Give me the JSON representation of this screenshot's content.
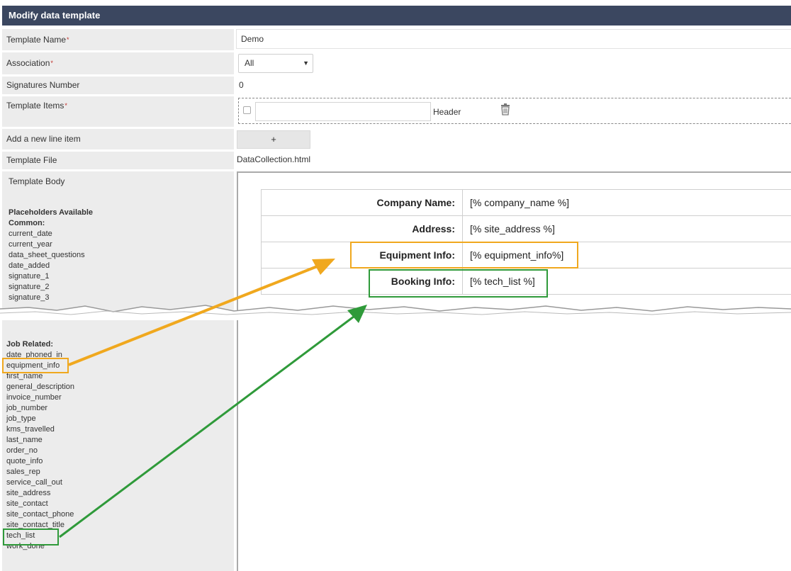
{
  "title": "Modify data template",
  "form": {
    "template_name_label": "Template Name",
    "template_name_value": "Demo",
    "association_label": "Association",
    "association_value": "All",
    "signatures_label": "Signatures Number",
    "signatures_value": "0",
    "template_items_label": "Template Items",
    "item_header_text": "Header",
    "add_line_label": "Add a new line item",
    "add_button": "+",
    "template_file_label": "Template File",
    "template_file_value": "DataCollection.html",
    "template_body_label": "Template Body",
    "required_mark": "*"
  },
  "placeholders": {
    "title": "Placeholders Available",
    "common_title": "Common:",
    "common": [
      "current_date",
      "current_year",
      "data_sheet_questions",
      "date_added",
      "signature_1",
      "signature_2",
      "signature_3"
    ],
    "job_title": "Job Related:",
    "job": [
      "date_phoned_in",
      "equipment_info",
      "first_name",
      "general_description",
      "invoice_number",
      "job_number",
      "job_type",
      "kms_travelled",
      "last_name",
      "order_no",
      "quote_info",
      "sales_rep",
      "service_call_out",
      "site_address",
      "site_contact",
      "site_contact_phone",
      "site_contact_title",
      "tech_list",
      "work_done"
    ]
  },
  "preview": {
    "rows": [
      {
        "key": "Company Name:",
        "value": "[% company_name %]"
      },
      {
        "key": "Address:",
        "value": "[% site_address %]"
      },
      {
        "key": "Equipment Info:",
        "value": "[% equipment_info%]"
      },
      {
        "key": "Booking Info:",
        "value": "[% tech_list %]"
      }
    ]
  },
  "colors": {
    "title_bar": "#3b4760",
    "highlight_orange": "#f0a81e",
    "highlight_green": "#2f9a3a",
    "required": "#c0302a"
  }
}
